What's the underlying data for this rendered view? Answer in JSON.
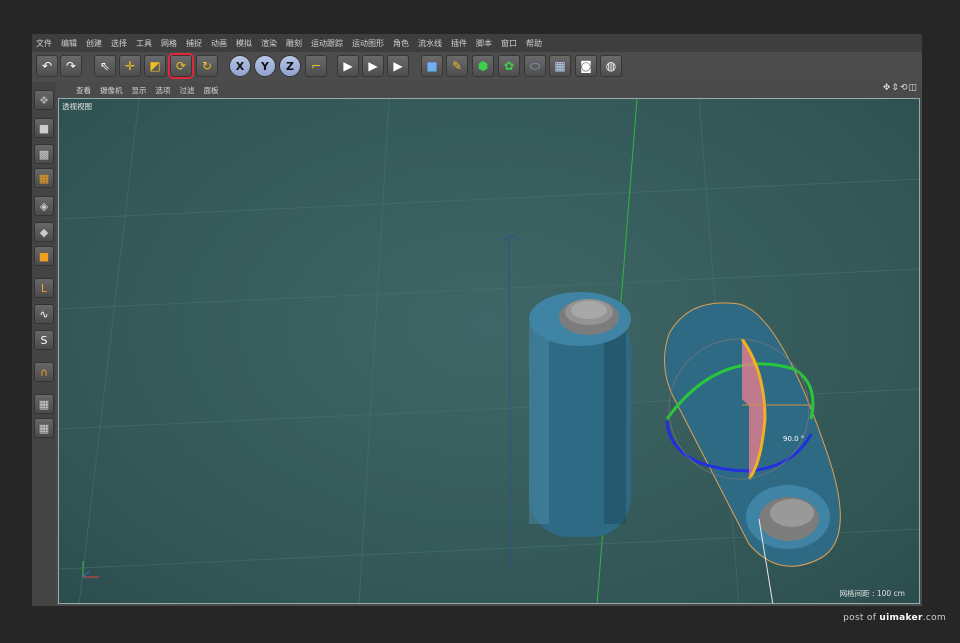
{
  "menu": [
    "文件",
    "编辑",
    "创建",
    "选择",
    "工具",
    "网格",
    "捕捉",
    "动画",
    "模拟",
    "渲染",
    "雕刻",
    "运动跟踪",
    "运动图形",
    "角色",
    "流水线",
    "插件",
    "脚本",
    "窗口",
    "帮助"
  ],
  "toolbar": {
    "icons": [
      "undo-icon",
      "redo-icon",
      "select-arrow-icon",
      "move-icon",
      "scale-icon",
      "rotate-icon",
      "recent-tool-icon",
      "x-axis-icon",
      "y-axis-icon",
      "z-axis-icon",
      "coordinate-system-icon",
      "render-view-icon",
      "render-picture-icon",
      "render-settings-icon",
      "cube-icon",
      "pen-icon",
      "subdivision-icon",
      "cloner-icon",
      "deformer-icon",
      "floor-icon",
      "camera-icon",
      "light-icon"
    ],
    "axis_labels": [
      "X",
      "Y",
      "Z"
    ],
    "selected_tool": "rotate-icon",
    "selection_color": "#e0283a"
  },
  "sidebar": {
    "icons": [
      "make-editable-icon",
      "model-mode-icon",
      "texture-mode-icon",
      "points-mode-icon",
      "edges-mode-icon",
      "polygons-mode-icon",
      "axis-mode-icon",
      "tweak-mode-icon",
      "solo-icon",
      "snap-magnet-icon",
      "workplane-icon",
      "workplane-lock-icon"
    ]
  },
  "viewport_menu": [
    "查看",
    "摄像机",
    "显示",
    "选项",
    "过滤",
    "面板"
  ],
  "viewport": {
    "label": "透视视图",
    "grid_info": "网格间距 : 100 cm",
    "rotation_readout": "90.0 °",
    "background_color": "#335757",
    "object_color": "#2f6a85"
  },
  "credit": {
    "prefix": "post of ",
    "site": "uimaker",
    "suffix": ".com"
  }
}
